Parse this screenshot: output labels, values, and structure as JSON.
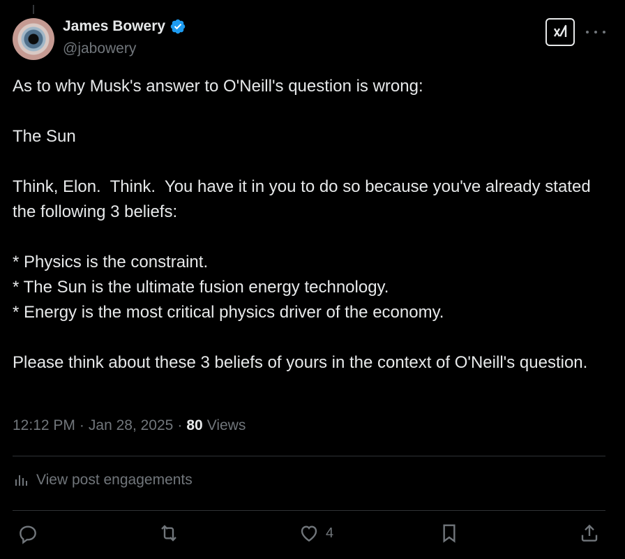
{
  "author": {
    "display_name": "James Bowery",
    "handle": "@jabowery",
    "verified": true
  },
  "post": {
    "paragraphs": [
      "As to why Musk's answer to O'Neill's question is wrong:",
      "The Sun",
      "Think, Elon.  Think.  You have it in you to do so because you've already stated the following 3 beliefs:",
      "* Physics is the constraint.\n* The Sun is the ultimate fusion energy technology.\n* Energy is the most critical physics driver of the economy.",
      "Please think about these 3 beliefs of yours in the context of O'Neill's question."
    ],
    "time": "12:12 PM",
    "separator": "·",
    "date": "Jan 28, 2025",
    "views_count": "80",
    "views_label": "Views"
  },
  "engagements_link": "View post engagements",
  "actions": {
    "reply": {
      "icon": "reply-icon"
    },
    "repost": {
      "icon": "repost-icon"
    },
    "like": {
      "icon": "heart-icon",
      "count": "4"
    },
    "bookmark": {
      "icon": "bookmark-icon"
    },
    "share": {
      "icon": "share-icon"
    }
  },
  "colors": {
    "background": "#000000",
    "text": "#e7e9ea",
    "muted": "#71767b",
    "verified": "#1d9bf0",
    "divider": "#2f3336"
  }
}
